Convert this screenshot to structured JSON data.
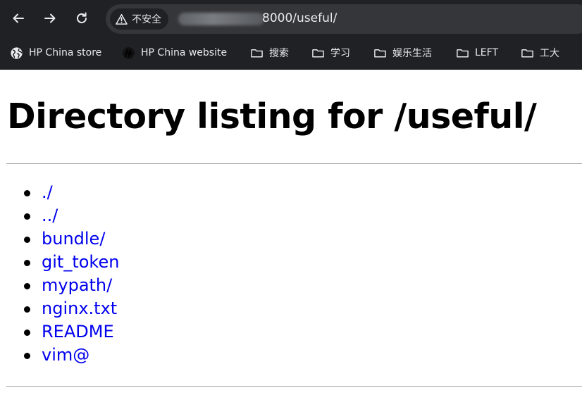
{
  "browser": {
    "security_label": "不安全",
    "url_visible": "8000/useful/",
    "bookmarks": [
      {
        "label": "HP China store",
        "icon": "globe-icon"
      },
      {
        "label": "HP China website",
        "icon": "hp-logo-icon"
      },
      {
        "label": "搜索",
        "icon": "folder-icon"
      },
      {
        "label": "学习",
        "icon": "folder-icon"
      },
      {
        "label": "娱乐生活",
        "icon": "folder-icon"
      },
      {
        "label": "LEFT",
        "icon": "folder-icon"
      },
      {
        "label": "工大",
        "icon": "folder-icon"
      }
    ]
  },
  "page": {
    "title": "Directory listing for /useful/",
    "entries": [
      "./",
      "../",
      "bundle/",
      "git_token",
      "mypath/",
      "nginx.txt",
      "README",
      "vim@"
    ]
  },
  "colors": {
    "chrome_bg": "#202124",
    "omnibox_bg": "#35363a",
    "link": "#0000ee"
  }
}
